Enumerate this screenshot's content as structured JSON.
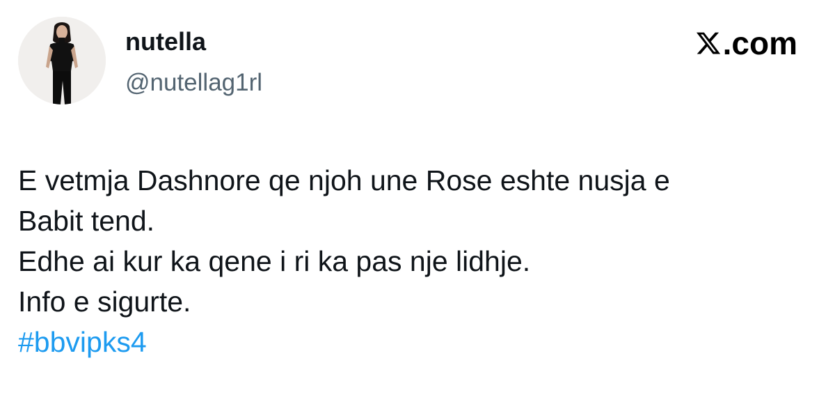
{
  "author": {
    "display_name": "nutella",
    "handle": "@nutellag1rl",
    "avatar_icon": "profile-photo"
  },
  "brand": {
    "icon": "x-logo-icon",
    "label": ".com",
    "color": "#000000"
  },
  "tweet": {
    "lines": [
      "E vetmja Dashnore qe njoh une Rose eshte nusja e",
      "Babit tend.",
      "Edhe ai kur ka qene i ri ka pas nje lidhje.",
      "Info e sigurte."
    ],
    "hashtag": "#bbvipks4",
    "hashtag_color": "#1d9bf0"
  }
}
